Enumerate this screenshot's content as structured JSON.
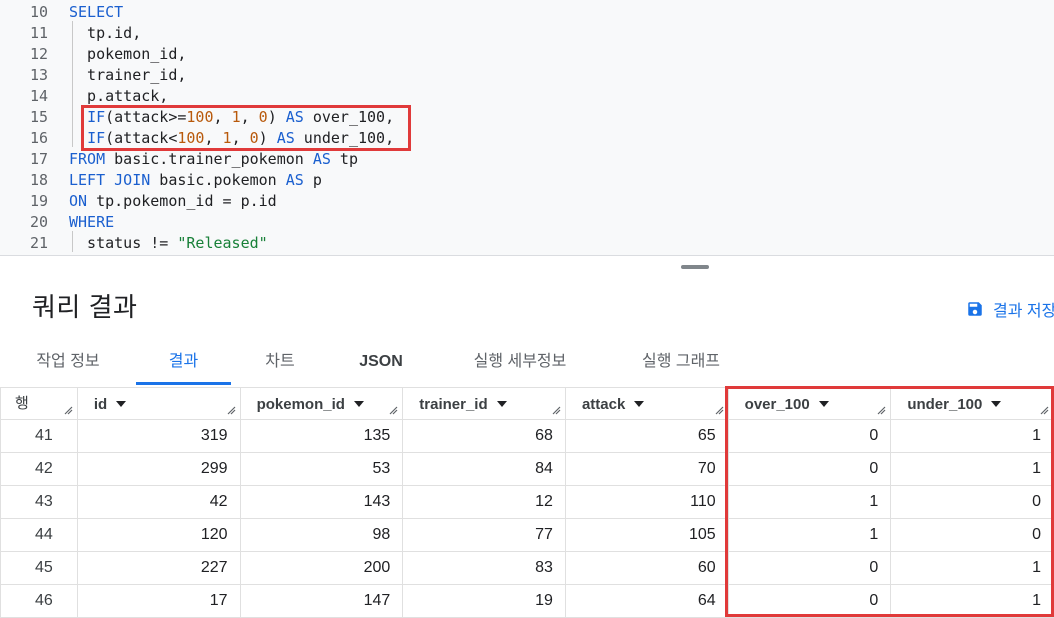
{
  "editor": {
    "lines": [
      {
        "num": "10",
        "tokens": [
          {
            "t": "SELECT",
            "c": "kw"
          }
        ]
      },
      {
        "num": "11",
        "tokens": [
          {
            "t": "  tp.id,",
            "c": ""
          }
        ]
      },
      {
        "num": "12",
        "tokens": [
          {
            "t": "  pokemon_id,",
            "c": ""
          }
        ]
      },
      {
        "num": "13",
        "tokens": [
          {
            "t": "  trainer_id,",
            "c": ""
          }
        ]
      },
      {
        "num": "14",
        "tokens": [
          {
            "t": "  p.attack,",
            "c": ""
          }
        ]
      },
      {
        "num": "15",
        "tokens": [
          {
            "t": "  ",
            "c": ""
          },
          {
            "t": "IF",
            "c": "kw"
          },
          {
            "t": "(attack>=",
            "c": ""
          },
          {
            "t": "100",
            "c": "num"
          },
          {
            "t": ", ",
            "c": ""
          },
          {
            "t": "1",
            "c": "num"
          },
          {
            "t": ", ",
            "c": ""
          },
          {
            "t": "0",
            "c": "num"
          },
          {
            "t": ") ",
            "c": ""
          },
          {
            "t": "AS",
            "c": "kw"
          },
          {
            "t": " over_100,",
            "c": ""
          }
        ]
      },
      {
        "num": "16",
        "tokens": [
          {
            "t": "  ",
            "c": ""
          },
          {
            "t": "IF",
            "c": "kw"
          },
          {
            "t": "(attack<",
            "c": ""
          },
          {
            "t": "100",
            "c": "num"
          },
          {
            "t": ", ",
            "c": ""
          },
          {
            "t": "1",
            "c": "num"
          },
          {
            "t": ", ",
            "c": ""
          },
          {
            "t": "0",
            "c": "num"
          },
          {
            "t": ") ",
            "c": ""
          },
          {
            "t": "AS",
            "c": "kw"
          },
          {
            "t": " under_100,",
            "c": ""
          }
        ]
      },
      {
        "num": "17",
        "tokens": [
          {
            "t": "FROM",
            "c": "kw"
          },
          {
            "t": " basic.trainer_pokemon ",
            "c": ""
          },
          {
            "t": "AS",
            "c": "kw"
          },
          {
            "t": " tp",
            "c": ""
          }
        ]
      },
      {
        "num": "18",
        "tokens": [
          {
            "t": "LEFT JOIN",
            "c": "kw"
          },
          {
            "t": " basic.pokemon ",
            "c": ""
          },
          {
            "t": "AS",
            "c": "kw"
          },
          {
            "t": " p",
            "c": ""
          }
        ]
      },
      {
        "num": "19",
        "tokens": [
          {
            "t": "ON",
            "c": "kw"
          },
          {
            "t": " tp.pokemon_id = p.id",
            "c": ""
          }
        ]
      },
      {
        "num": "20",
        "tokens": [
          {
            "t": "WHERE",
            "c": "kw"
          }
        ]
      },
      {
        "num": "21",
        "tokens": [
          {
            "t": "  status != ",
            "c": ""
          },
          {
            "t": "\"Released\"",
            "c": "str"
          }
        ]
      }
    ]
  },
  "results": {
    "title": "쿼리 결과",
    "save_label": "결과 저장",
    "tabs": [
      {
        "label": "작업 정보",
        "active": false,
        "bold": false
      },
      {
        "label": "결과",
        "active": true,
        "bold": false
      },
      {
        "label": "차트",
        "active": false,
        "bold": false
      },
      {
        "label": "JSON",
        "active": false,
        "bold": true
      },
      {
        "label": "실행 세부정보",
        "active": false,
        "bold": false
      },
      {
        "label": "실행 그래프",
        "active": false,
        "bold": false
      }
    ],
    "row_header": "행",
    "columns": [
      "id",
      "pokemon_id",
      "trainer_id",
      "attack",
      "over_100",
      "under_100"
    ],
    "rows": [
      {
        "row": "41",
        "cells": [
          "319",
          "135",
          "68",
          "65",
          "0",
          "1"
        ]
      },
      {
        "row": "42",
        "cells": [
          "299",
          "53",
          "84",
          "70",
          "0",
          "1"
        ]
      },
      {
        "row": "43",
        "cells": [
          "42",
          "143",
          "12",
          "110",
          "1",
          "0"
        ]
      },
      {
        "row": "44",
        "cells": [
          "120",
          "98",
          "77",
          "105",
          "1",
          "0"
        ]
      },
      {
        "row": "45",
        "cells": [
          "227",
          "200",
          "83",
          "60",
          "0",
          "1"
        ]
      },
      {
        "row": "46",
        "cells": [
          "17",
          "147",
          "19",
          "64",
          "0",
          "1"
        ]
      }
    ]
  },
  "colors": {
    "accent": "#1a73e8",
    "highlight": "#e03a3a",
    "keyword": "#1a5fcf",
    "number": "#b8590b",
    "string": "#188038"
  },
  "icons": {
    "save": "save-icon",
    "sort": "caret-down-icon",
    "resize": "resize-handle-icon"
  }
}
